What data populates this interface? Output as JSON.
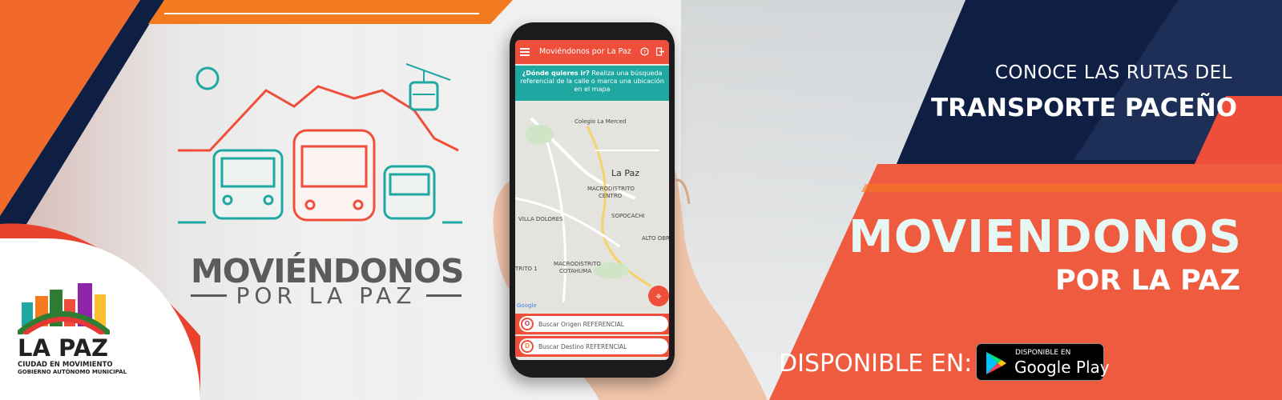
{
  "colors": {
    "accent": "#ef4e3a",
    "orange": "#f47a20",
    "navy": "#0f1f44",
    "teal": "#1fa8a2",
    "grey_logo": "#5b5b5b"
  },
  "left_logo": {
    "title": "MOVIÉNDONOS",
    "subtitle": "POR LA PAZ"
  },
  "city_logo": {
    "name": "LA PAZ",
    "tagline": "CIUDAD EN MOVIMIENTO",
    "subtagline": "GOBIERNO AUTÓNOMO MUNICIPAL"
  },
  "phone_app": {
    "title": "Moviéndonos por La Paz",
    "icons": [
      "menu-icon",
      "help-icon",
      "logout-icon"
    ],
    "tip_bold": "¿Dónde quieres ir?",
    "tip_text": " Realiza una búsqueda referencial de la calle o marca una ubicación en el mapa",
    "map_labels": {
      "colegio": "Colegio La Merced",
      "city": "La Paz",
      "macro_centro_1": "MACRODISTRITO",
      "macro_centro_2": "CENTRO",
      "villa": "VILLA DOLORES",
      "sopocachi": "SOPOCACHI",
      "alto": "ALTO OBRA...",
      "distrito1": "TRITO 1",
      "macro_cot_1": "MACRODISTRITO",
      "macro_cot_2": "COTAHUMA",
      "google": "Google"
    },
    "origin_badge": "O",
    "origin_placeholder": "Buscar Origen REFERENCIAL",
    "dest_badge": "D",
    "dest_placeholder": "Buscar Destino REFERENCIAL"
  },
  "right_panel": {
    "headline_small": "CONOCE LAS RUTAS DEL",
    "headline_big": "TRANSPORTE PACEÑO",
    "app_name": "MOVIENDONOS",
    "app_name_sub": "POR LA PAZ",
    "available_label": "DISPONIBLE EN:",
    "store_small": "DISPONIBLE EN",
    "store_big": "Google Play"
  }
}
